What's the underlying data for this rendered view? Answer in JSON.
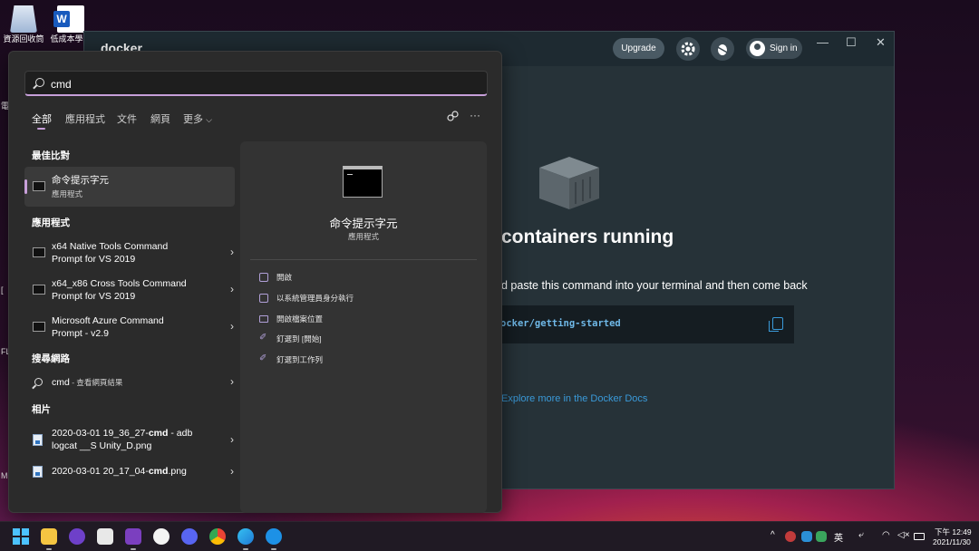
{
  "desktop": {
    "icons": [
      {
        "label": "資源回收筒"
      },
      {
        "label": "低成本學生 會用戶製"
      }
    ],
    "edge_letters": [
      "電",
      "[",
      "[",
      "FL",
      "M"
    ]
  },
  "docker": {
    "logo": "docker",
    "upgrade_label": "Upgrade",
    "signin_label": "Sign in",
    "heading": "containers running",
    "subtext": "d paste this command into your terminal and then come back",
    "command": "ocker/getting-started",
    "docs_link": "Explore more in the Docker Docs",
    "window_controls": {
      "minimize": "—",
      "maximize": "☐",
      "close": "✕"
    }
  },
  "search": {
    "query": "cmd",
    "tabs": [
      "全部",
      "應用程式",
      "文件",
      "網頁",
      "更多"
    ],
    "more_chevron": "⌵",
    "best_match_title": "最佳比對",
    "best_match": {
      "title": "命令提示字元",
      "subtitle": "應用程式"
    },
    "apps_title": "應用程式",
    "apps": [
      {
        "line1": "x64 Native Tools Command",
        "line2": "Prompt for VS 2019"
      },
      {
        "line1": "x64_x86 Cross Tools Command",
        "line2": "Prompt for VS 2019"
      },
      {
        "line1": "Microsoft Azure Command",
        "line2": "Prompt - v2.9"
      }
    ],
    "web_title": "搜尋網路",
    "web": {
      "query": "cmd",
      "suffix": " - 查看網頁結果"
    },
    "photos_title": "相片",
    "photos": [
      {
        "line1_pre": "2020-03-01 19_36_27-",
        "line1_bold": "cmd",
        "line1_post": " - adb",
        "line2": "logcat __S Unity_D.png"
      },
      {
        "line1_pre": "2020-03-01 20_17_04-",
        "line1_bold": "cmd",
        "line1_post": ".png",
        "line2": ""
      }
    ],
    "detail": {
      "title": "命令提示字元",
      "subtitle": "應用程式",
      "actions": [
        "開啟",
        "以系統管理員身分執行",
        "開啟檔案位置",
        "釘選到 [開始]",
        "釘選到工作列"
      ]
    }
  },
  "taskbar": {
    "tray": {
      "chevron": "^",
      "ime": "英",
      "time": "下午 12:49",
      "date": "2021/11/30"
    }
  },
  "colors": {
    "accent": "#c79fd9",
    "docker_link": "#3a9ad9",
    "panel_bg": "#2b2b2b"
  }
}
